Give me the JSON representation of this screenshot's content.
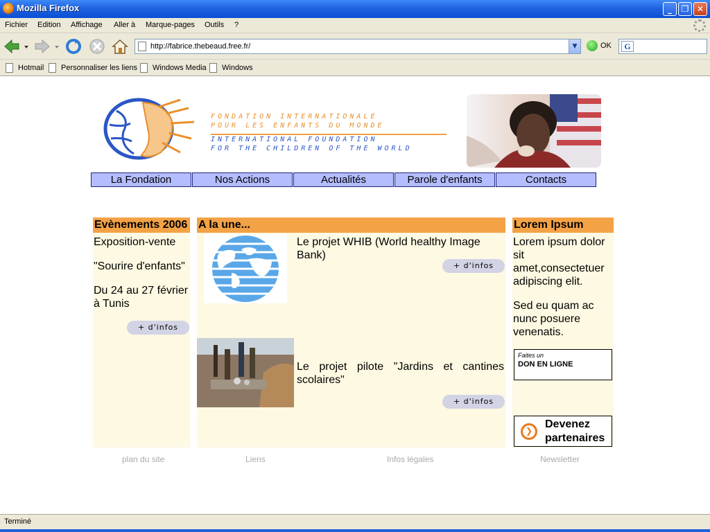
{
  "window": {
    "title": "Mozilla Firefox"
  },
  "menu": [
    "Fichier",
    "Edition",
    "Affichage",
    "Aller à",
    "Marque-pages",
    "Outils",
    "?"
  ],
  "navbar": {
    "url": "http://fabrice.thebeaud.free.fr/",
    "go_label": "OK",
    "search_value": ""
  },
  "bookmarks": [
    "Hotmail",
    "Personnaliser les liens",
    "Windows Media",
    "Windows"
  ],
  "site": {
    "logo_lines": [
      "FONDATION INTERNATIONALE",
      "POUR LES ENFANTS DU MONDE",
      "INTERNATIONAL FOUNDATION",
      "FOR THE CHILDREN OF THE WORLD"
    ],
    "nav": [
      "La Fondation",
      "Nos Actions",
      "Actualités",
      "Parole d'enfants",
      "Contacts"
    ],
    "events": {
      "heading": "Evènements 2006",
      "line1": "Exposition-vente",
      "line2": "\"Sourire d'enfants\"",
      "line3": "Du 24 au 27 février à Tunis",
      "more": "+ d'infos"
    },
    "headline": {
      "heading": "A la une...",
      "item1": "Le projet WHIB (World healthy Image Bank)",
      "item2": "Le projet pilote \"Jardins et cantines scolaires\"",
      "more": "+ d'infos"
    },
    "lorem": {
      "heading": "Lorem Ipsum",
      "p1": "Lorem ipsum dolor sit amet,consectetuer adipiscing elit.",
      "p2": "Sed eu quam ac nunc posuere venenatis.",
      "don_small": "Faites un",
      "don_big": "DON EN LIGNE",
      "partner": "Devenez partenaires"
    },
    "footer": [
      "plan du site",
      "Liens",
      "Infos légales",
      "Newsletter"
    ]
  },
  "status": {
    "text": "Terminé"
  },
  "colors": {
    "nav_bg": "#b4bdff",
    "header_orange": "#f4a246",
    "column_bg": "#fdf9e2"
  }
}
